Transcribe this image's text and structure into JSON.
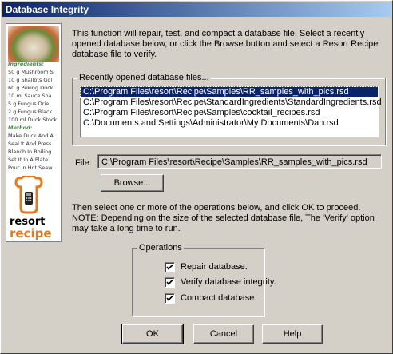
{
  "window": {
    "title": "Database Integrity"
  },
  "sidebar": {
    "ingredients_heading": "Ingredients:",
    "ingredients": [
      "50 g Mushroom S",
      "10 g Shallots Gol",
      "60 g Peking Duck",
      "10 ml Sauce Sha",
      "5 g Fungus Drie",
      "2 g Fungus Black",
      "100 ml Duck Stock"
    ],
    "method_heading": "Method:",
    "method": [
      "Make Duck And A",
      "Seal It And Press",
      "Blanch In Boiling",
      "Set It In A Plate",
      "Pour In Hot Seaw"
    ],
    "brand_line1": "resort",
    "brand_line2": "recipe"
  },
  "intro_text": "This function will repair, test, and compact a database file. Select a recently opened database below, or click the Browse button and select a Resort Recipe database file to verify.",
  "recent": {
    "label": "Recently opened database files...",
    "items": [
      "C:\\Program Files\\resort\\Recipe\\Samples\\RR_samples_with_pics.rsd",
      "C:\\Program Files\\resort\\Recipe\\StandardIngredients\\StandardIngredients.rsd",
      "C:\\Program Files\\resort\\Recipe\\Samples\\cocktail_recipes.rsd",
      "C:\\Documents and Settings\\Administrator\\My Documents\\Dan.rsd"
    ]
  },
  "file": {
    "label": "File:",
    "value": "C:\\Program Files\\resort\\Recipe\\Samples\\RR_samples_with_pics.rsd"
  },
  "browse_label": "Browse...",
  "note_text": "Then select one or more of the operations below, and click OK to proceed. NOTE: Depending on the size of the selected database file, The 'Verify' option may take a long time to run.",
  "operations": {
    "label": "Operations",
    "repair_label": "Repair database.",
    "verify_label": "Verify database integrity.",
    "compact_label": "Compact database.",
    "repair_checked": true,
    "verify_checked": true,
    "compact_checked": true
  },
  "buttons": {
    "ok": "OK",
    "cancel": "Cancel",
    "help": "Help"
  },
  "colors": {
    "title_start": "#0a246a",
    "title_end": "#a6caf0",
    "selection": "#0a246a",
    "brand_orange": "#e8781a"
  }
}
